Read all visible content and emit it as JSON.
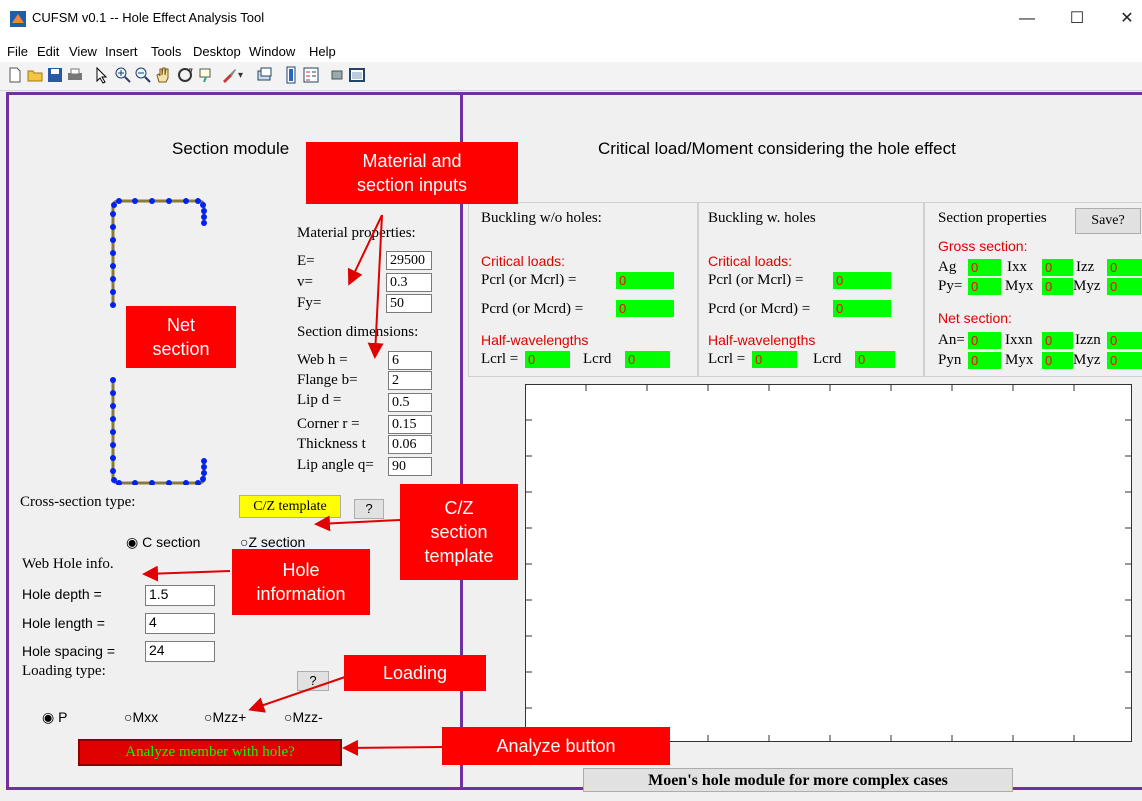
{
  "window": {
    "title": "CUFSM v0.1 -- Hole Effect Analysis Tool",
    "controls": [
      "—",
      "☐",
      "✕"
    ]
  },
  "menu": [
    "File",
    "Edit",
    "View",
    "Insert",
    "Tools",
    "Desktop",
    "Window",
    "Help"
  ],
  "toolbar_icons": [
    "new-file-icon",
    "open-folder-icon",
    "save-icon",
    "print-icon",
    "pointer-icon",
    "zoom-in-icon",
    "zoom-out-icon",
    "pan-hand-icon",
    "rotate-3d-icon",
    "data-cursor-icon",
    "brush-icon",
    "link-icon",
    "colorbar-icon",
    "legend-icon",
    "hide-plot-tools-icon",
    "show-plot-tools-icon"
  ],
  "left": {
    "title": "Section module",
    "material_heading": "Material properties:",
    "E_label": "E=",
    "E_value": "29500",
    "v_label": "v=",
    "v_value": "0.3",
    "Fy_label": "Fy=",
    "Fy_value": "50",
    "dims_heading": "Section dimensions:",
    "web_label": "Web h =",
    "web_value": "6",
    "flange_label": "Flange b=",
    "flange_value": "2",
    "lip_label": "Lip d =",
    "lip_value": "0.5",
    "corner_label": "Corner r =",
    "corner_value": "0.15",
    "thick_label": "Thickness t",
    "thick_value": "0.06",
    "angle_label": "Lip angle q=",
    "angle_value": "90",
    "cs_type_label": "Cross-section type:",
    "template_btn": "C/Z template",
    "help_btn": "?",
    "c_section": "C section",
    "z_section": "Z section",
    "web_hole_label": "Web Hole info.",
    "hole_depth_label": "Hole depth =",
    "hole_depth_value": "1.5",
    "hole_length_label": "Hole length =",
    "hole_length_value": "4",
    "hole_spacing_label": "Hole spacing =",
    "hole_spacing_value": "24",
    "loading_label": "Loading type:",
    "loading_help": "?",
    "load_P": "P",
    "load_Mxx": "Mxx",
    "load_Mzzp": "Mzz+",
    "load_Mzzm": "Mzz-",
    "analyze_btn": "Analyze member with hole?"
  },
  "right": {
    "title": "Critical load/Moment considering the hole effect",
    "wo_heading": "Buckling w/o holes:",
    "w_heading": "Buckling w. holes",
    "critical_loads": "Critical loads:",
    "pcrl": "Pcrl (or Mcrl) =",
    "pcrd": "Pcrd (or Mcrd) =",
    "half_wl": "Half-wavelengths",
    "lcrl": "Lcrl =",
    "lcrd": "Lcrd",
    "zero": "0",
    "props_heading": "Section properties",
    "save_btn": "Save?",
    "gross": "Gross section:",
    "ag": "Ag",
    "ixx": "Ixx",
    "izz": "Izz",
    "py": "Py=",
    "myx": "Myx",
    "myz": "Myz",
    "net": "Net section:",
    "an": "An=",
    "ixxn": "Ixxn",
    "izzn": "Izzn",
    "pyn": "Pyn",
    "moen_btn": "Moen's hole module for more complex cases"
  },
  "callouts": {
    "material": [
      "Material and",
      "section inputs"
    ],
    "net": [
      "Net",
      "section"
    ],
    "template": [
      "C/Z",
      "section",
      "template"
    ],
    "hole": [
      "Hole",
      "information"
    ],
    "loading": "Loading",
    "analyze": "Analyze button"
  },
  "colors": {
    "panel_border": "#7030a0",
    "callout": "#ff0000",
    "field_green": "#00ff00",
    "section_blue": "#0022ee"
  }
}
